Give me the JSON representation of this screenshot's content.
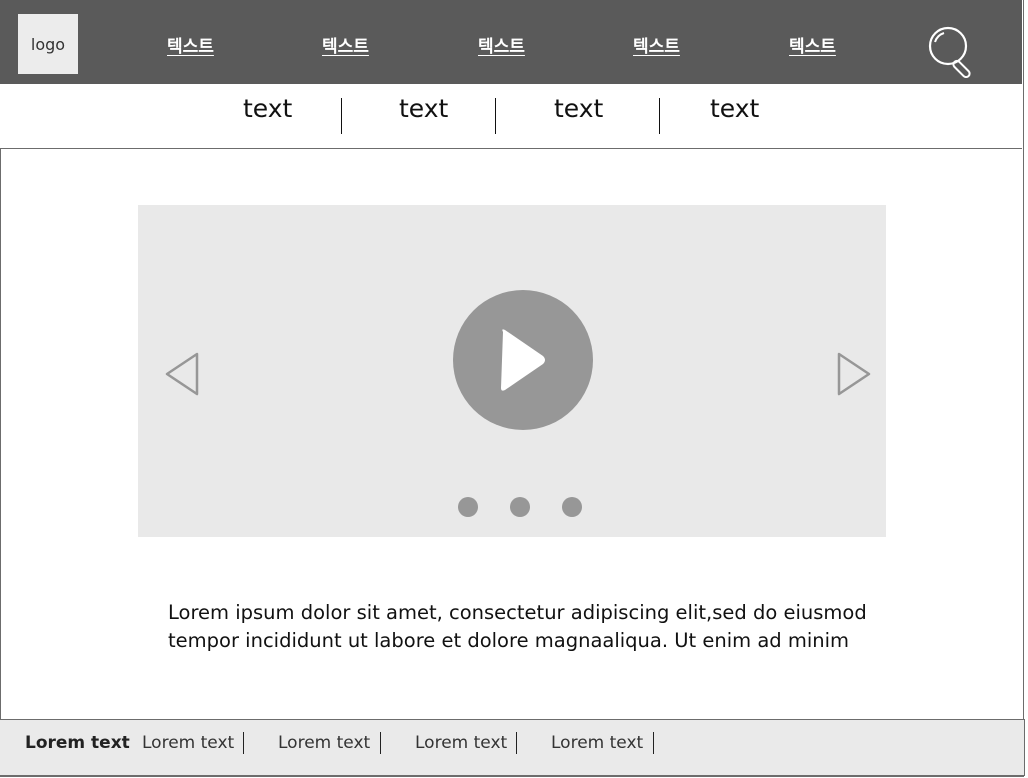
{
  "header": {
    "logo": "logo",
    "nav": [
      "텍스트",
      "텍스트",
      "텍스트",
      "텍스트",
      "텍스트"
    ],
    "search_icon": "search-icon"
  },
  "subnav": {
    "items": [
      "text",
      "text",
      "text",
      "text"
    ]
  },
  "media": {
    "play_icon": "play-icon",
    "prev_icon": "chevron-left-icon",
    "next_icon": "chevron-right-icon",
    "slide_count": 3
  },
  "description": {
    "line1": "Lorem ipsum dolor sit amet, consectetur adipiscing elit,sed do eiusmod",
    "line2": "tempor incididunt ut labore et dolore magnaaliqua. Ut enim ad minim"
  },
  "footer": {
    "items": [
      "Lorem text",
      "Lorem text",
      "Lorem text",
      "Lorem text",
      "Lorem text"
    ]
  },
  "colors": {
    "header_bg": "#5a5a5a",
    "media_bg": "#e9e9e9",
    "accent_gray": "#979797",
    "footer_bg": "#eaeaea"
  }
}
